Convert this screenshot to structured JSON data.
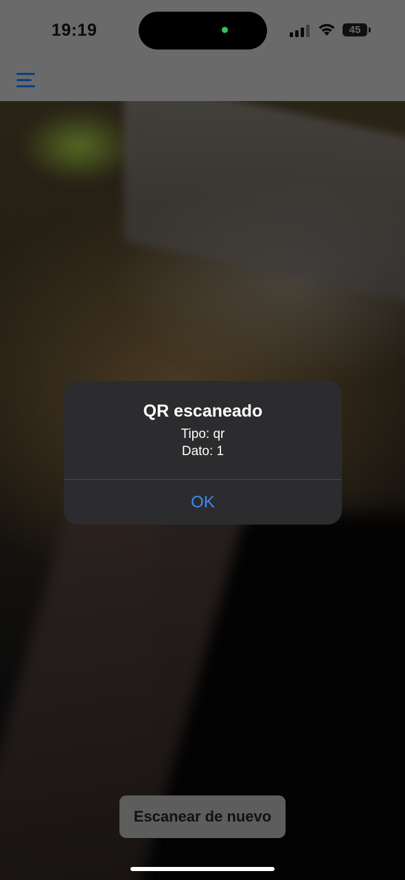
{
  "status_bar": {
    "time": "19:19",
    "battery": "45",
    "signal_bars": 3,
    "icons": [
      "cellular-signal-icon",
      "wifi-icon",
      "battery-icon"
    ]
  },
  "header": {
    "menu_icon": "hamburger-menu-icon",
    "accent_color": "#0a3f82"
  },
  "alert": {
    "title": "QR escaneado",
    "line1": "Tipo: qr",
    "line2": "Dato: 1",
    "ok_label": "OK",
    "ok_color": "#3e8bf0"
  },
  "actions": {
    "rescan_label": "Escanear de nuevo"
  }
}
